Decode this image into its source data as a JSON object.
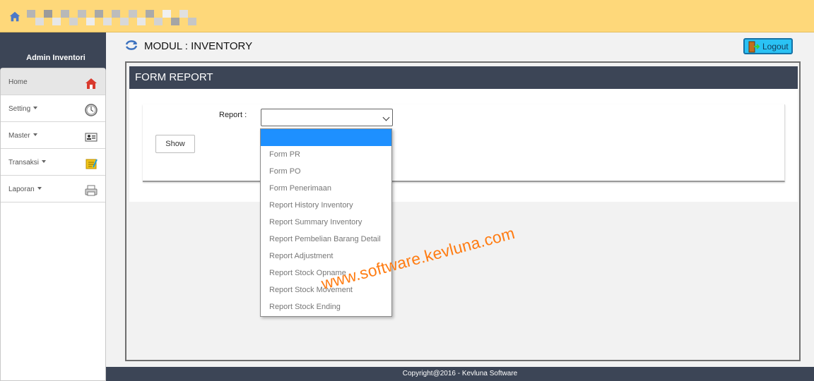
{
  "top": {
    "home_icon": "home-icon",
    "pixel_colors": [
      "#b5b5b5",
      "#dddddd",
      "#9b9b9b",
      "#e7e7e7",
      "#b8b8b8",
      "#d1d1d1",
      "#c0c0c0",
      "#ececec",
      "#a8a8a8",
      "#dfdfdf",
      "#bcbcbc",
      "#d8d8d8",
      "#c7c7c7",
      "#e7e7e7",
      "#aaaaaa",
      "#d2d2d2",
      "#f0f0f0",
      "#a5a5a5",
      "#e0e0e0",
      "#c6c6c6"
    ]
  },
  "sidebar": {
    "title": "Admin Inventori",
    "items": [
      {
        "label": "Home",
        "icon": "home-icon",
        "active": true
      },
      {
        "label": "Setting",
        "icon": "settings-clock-icon"
      },
      {
        "label": "Master",
        "icon": "id-card-icon"
      },
      {
        "label": "Transaksi",
        "icon": "notepad-icon"
      },
      {
        "label": "Laporan",
        "icon": "printer-icon"
      }
    ]
  },
  "main": {
    "module_title": "MODUL : INVENTORY",
    "logout_label": "Logout",
    "panel_title": "FORM REPORT",
    "report_label": "Report :",
    "select_value": "",
    "show_label": "Show"
  },
  "dropdown": {
    "options": [
      "",
      "Form PR",
      "Form PO",
      "Form Penerimaan",
      "Report History Inventory",
      "Report Summary Inventory",
      "Report Pembelian Barang Detail",
      "Report Adjustment",
      "Report Stock Opname",
      "Report Stock Movement",
      "Report Stock Ending"
    ]
  },
  "watermark": "www.software.kevluna.com",
  "footer": {
    "text": "Copyright@2016 - Kevluna Software"
  },
  "colors": {
    "topbar": "#fed87a",
    "navy": "#3c4556",
    "logout": "#2ac2f4",
    "selection": "#1e90ff",
    "watermark": "#ff7c12"
  }
}
